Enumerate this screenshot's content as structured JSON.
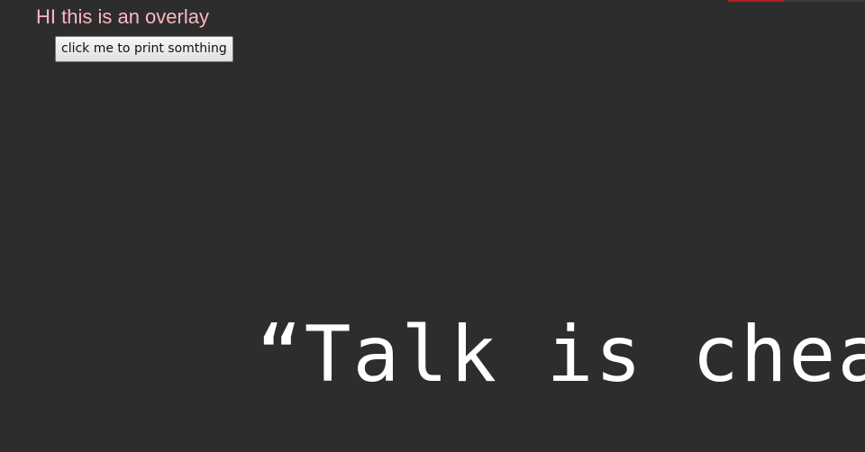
{
  "overlay": {
    "title": "HI this is an overlay",
    "button_label": "click me to print somthing"
  },
  "background": {
    "quote": "“Talk is cheap. Sh"
  },
  "colors": {
    "background": "#2d2d2d",
    "overlay_text": "#ffb6c1",
    "quote_text": "#ffffff",
    "top_strip_accent": "#b01c24"
  }
}
